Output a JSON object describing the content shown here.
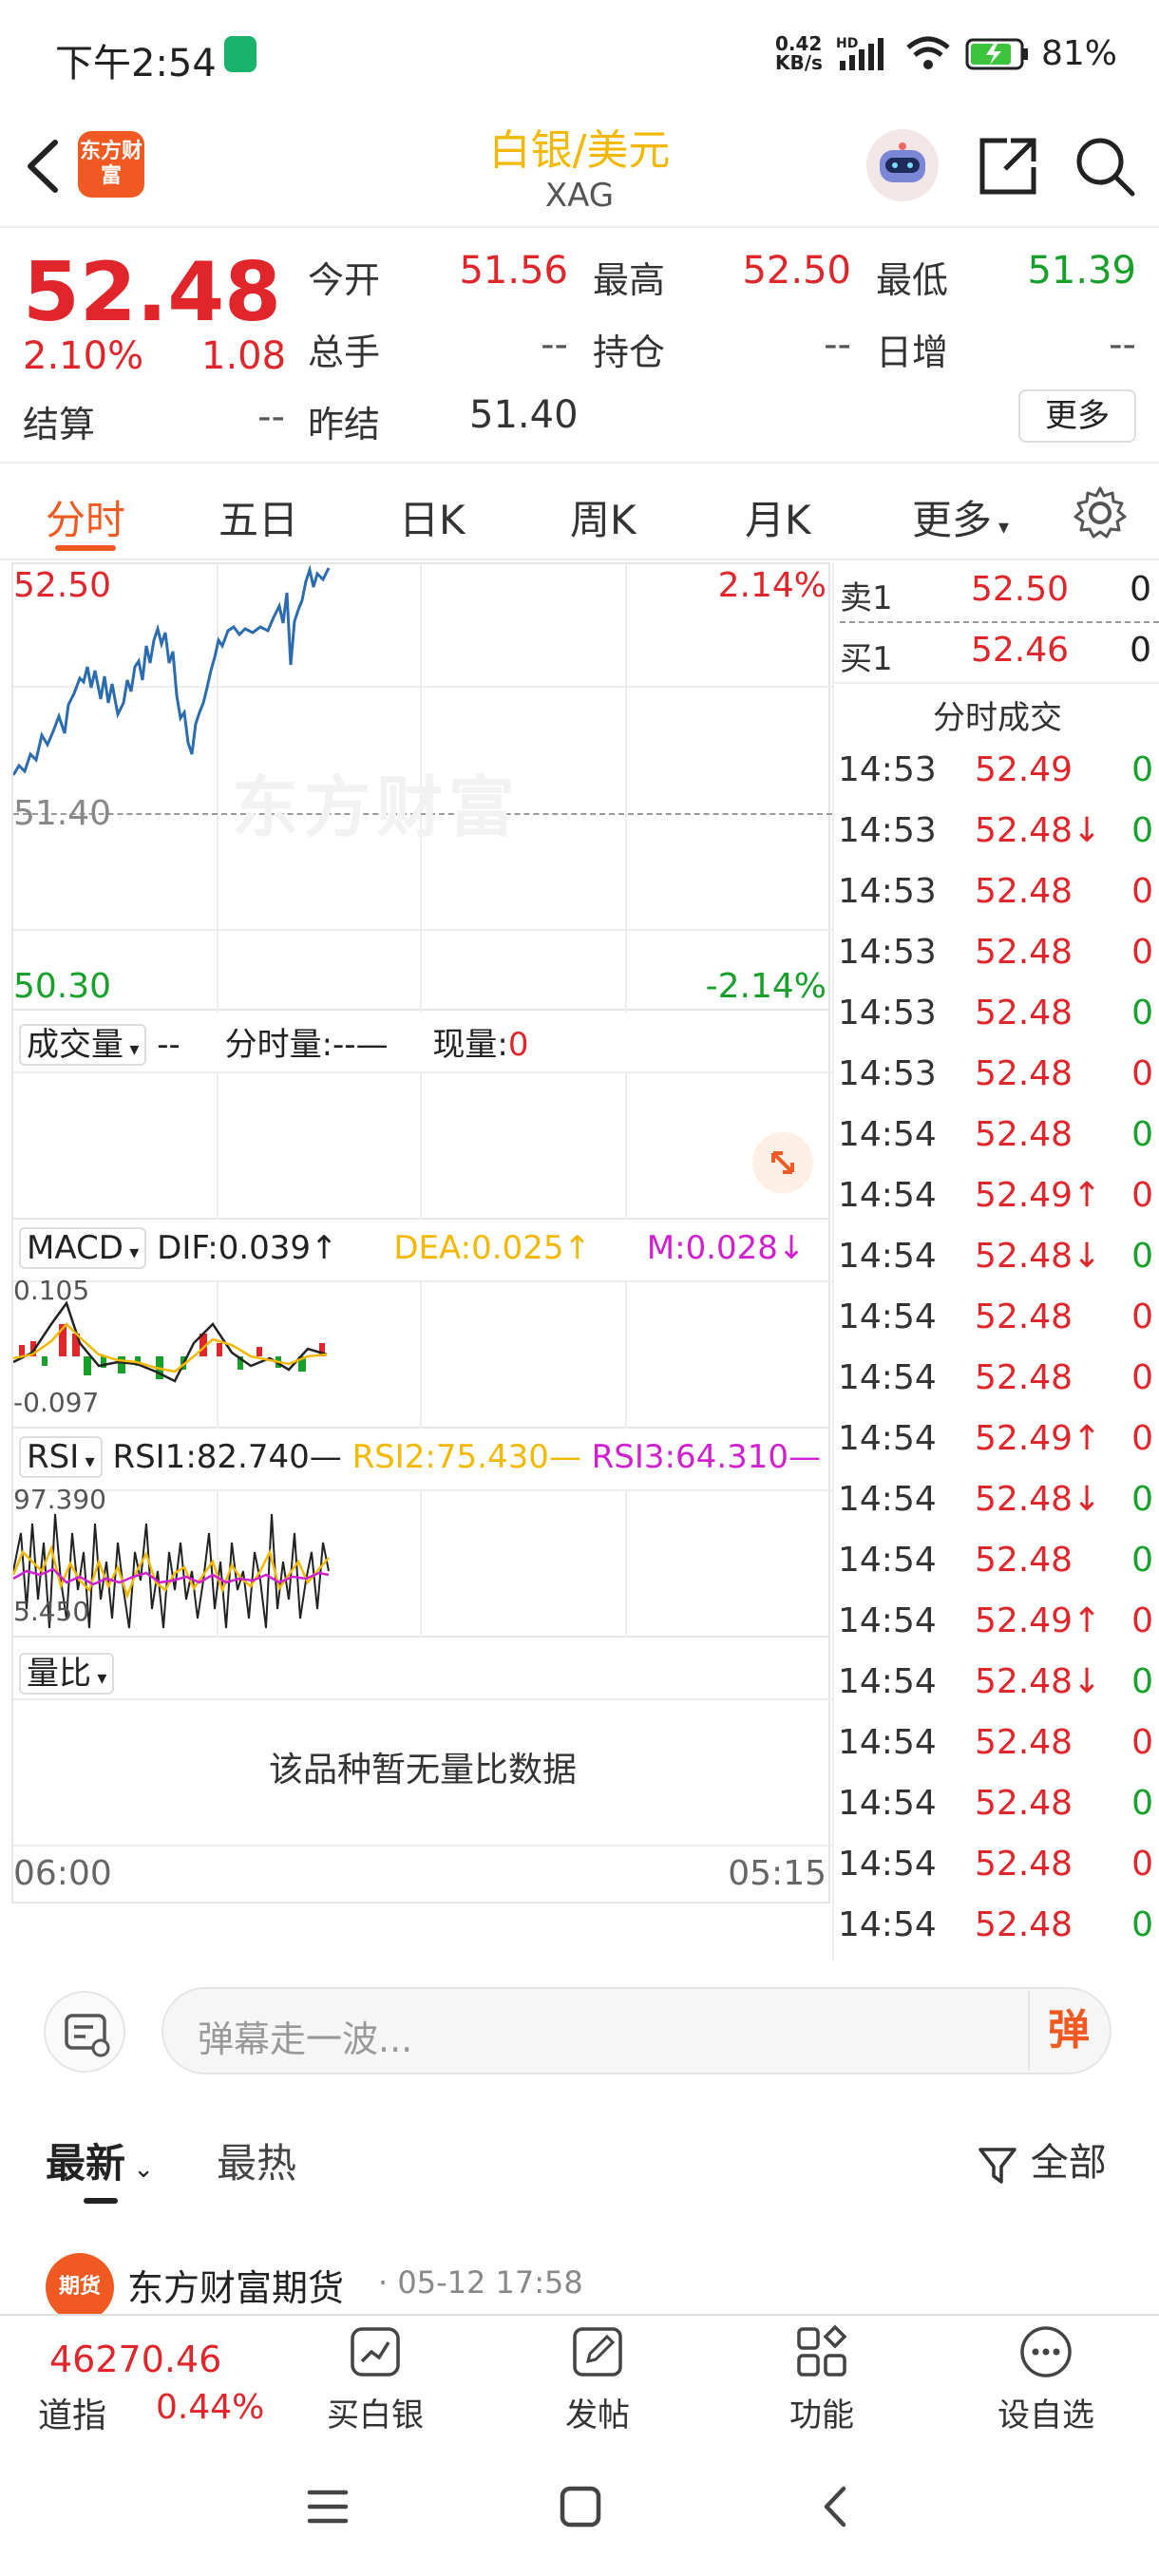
{
  "status_bar": {
    "time": "下午2:54",
    "net_speed_top": "0.42",
    "net_speed_bottom": "KB/s",
    "hd": "HD",
    "battery": "81%"
  },
  "header": {
    "logo_text": "东方财富",
    "title": "白银/美元",
    "subtitle": "XAG"
  },
  "quote": {
    "price": "52.48",
    "change_pct": "2.10%",
    "change": "1.08",
    "settle_label": "结算",
    "settle_value": "--",
    "open_label": "今开",
    "open_value": "51.56",
    "volume_label": "总手",
    "volume_value": "--",
    "prev_settle_label": "昨结",
    "prev_settle_value": "51.40",
    "high_label": "最高",
    "high_value": "52.50",
    "oi_label": "持仓",
    "oi_value": "--",
    "low_label": "最低",
    "low_value": "51.39",
    "daily_inc_label": "日增",
    "daily_inc_value": "--",
    "more_label": "更多"
  },
  "tabs": {
    "items": [
      "分时",
      "五日",
      "日K",
      "周K",
      "月K",
      "更多"
    ],
    "active": 0
  },
  "chart": {
    "top_price": "52.50",
    "top_pct": "2.14%",
    "mid_price": "51.40",
    "bottom_price": "50.30",
    "bottom_pct": "-2.14%",
    "watermark": "东方财富"
  },
  "volume_panel": {
    "selector": "成交量",
    "dash": "--",
    "fenshi_label": "分时量:--—",
    "xian_label": "现量:",
    "xian_value": "0"
  },
  "macd_panel": {
    "selector": "MACD",
    "dif": "DIF:0.039↑",
    "dea": "DEA:0.025↑",
    "m": "M:0.028↓",
    "top": "0.105",
    "bottom": "-0.097"
  },
  "rsi_panel": {
    "selector": "RSI",
    "rsi1": "RSI1:82.740—",
    "rsi2": "RSI2:75.430—",
    "rsi3": "RSI3:64.310—",
    "top": "97.390",
    "bottom": "5.450"
  },
  "ratio_panel": {
    "selector": "量比",
    "empty_text": "该品种暂无量比数据"
  },
  "time_axis": {
    "start": "06:00",
    "end": "05:15"
  },
  "order_book": {
    "sell_label": "卖1",
    "sell_price": "52.50",
    "sell_vol": "0",
    "buy_label": "买1",
    "buy_price": "52.46",
    "buy_vol": "0",
    "trades_title": "分时成交"
  },
  "trades": [
    {
      "time": "14:53",
      "price": "52.49",
      "vol": "0",
      "vol_color": "green"
    },
    {
      "time": "14:53",
      "price": "52.48↓",
      "vol": "0",
      "vol_color": "green"
    },
    {
      "time": "14:53",
      "price": "52.48",
      "vol": "0",
      "vol_color": "red"
    },
    {
      "time": "14:53",
      "price": "52.48",
      "vol": "0",
      "vol_color": "red"
    },
    {
      "time": "14:53",
      "price": "52.48",
      "vol": "0",
      "vol_color": "green"
    },
    {
      "time": "14:53",
      "price": "52.48",
      "vol": "0",
      "vol_color": "red"
    },
    {
      "time": "14:54",
      "price": "52.48",
      "vol": "0",
      "vol_color": "green"
    },
    {
      "time": "14:54",
      "price": "52.49↑",
      "vol": "0",
      "vol_color": "red"
    },
    {
      "time": "14:54",
      "price": "52.48↓",
      "vol": "0",
      "vol_color": "green"
    },
    {
      "time": "14:54",
      "price": "52.48",
      "vol": "0",
      "vol_color": "red"
    },
    {
      "time": "14:54",
      "price": "52.48",
      "vol": "0",
      "vol_color": "red"
    },
    {
      "time": "14:54",
      "price": "52.49↑",
      "vol": "0",
      "vol_color": "red"
    },
    {
      "time": "14:54",
      "price": "52.48↓",
      "vol": "0",
      "vol_color": "green"
    },
    {
      "time": "14:54",
      "price": "52.48",
      "vol": "0",
      "vol_color": "green"
    },
    {
      "time": "14:54",
      "price": "52.49↑",
      "vol": "0",
      "vol_color": "red"
    },
    {
      "time": "14:54",
      "price": "52.48↓",
      "vol": "0",
      "vol_color": "green"
    },
    {
      "time": "14:54",
      "price": "52.48",
      "vol": "0",
      "vol_color": "red"
    },
    {
      "time": "14:54",
      "price": "52.48",
      "vol": "0",
      "vol_color": "green"
    },
    {
      "time": "14:54",
      "price": "52.48",
      "vol": "0",
      "vol_color": "red"
    },
    {
      "time": "14:54",
      "price": "52.48",
      "vol": "0",
      "vol_color": "green"
    }
  ],
  "barrage": {
    "placeholder": "弹幕走一波...",
    "send_label": "弹"
  },
  "feed_tabs": {
    "latest": "最新",
    "hot": "最热",
    "filter": "全部"
  },
  "post": {
    "author": "东方财富期货",
    "date": "· 05-12 17:58",
    "avatar_text": "期货"
  },
  "bottom_bar": {
    "index_value": "46270.46",
    "index_name": "道指",
    "index_pct": "0.44%",
    "buy_label": "买白银",
    "post_label": "发帖",
    "func_label": "功能",
    "watch_label": "设自选"
  },
  "colors": {
    "up": "#e0262b",
    "down": "#17a02a",
    "accent": "#f05a22",
    "title": "#f5b800"
  }
}
